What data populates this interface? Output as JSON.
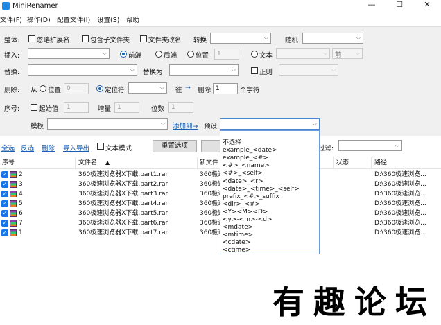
{
  "window": {
    "title": "MiniRenamer",
    "minimize": "—",
    "maximize": "☐",
    "close": "✕"
  },
  "menu": [
    "文件(F)",
    "操作(D)",
    "配置文件(I)",
    "设置(S)",
    "帮助"
  ],
  "overall": {
    "label": "整体:",
    "ignore_ext": "忽略扩展名",
    "include_subfiles": "包含子文件夹",
    "folder_rename": "文件夹改名",
    "convert_label": "转换",
    "random_label": "随机"
  },
  "insert": {
    "label": "插入:",
    "front": "前端",
    "back": "后端",
    "position": "位置",
    "position_value": "1",
    "text": "文本",
    "before_after": "前"
  },
  "replace": {
    "label": "替换:",
    "replace_with": "替换为",
    "regex": "正则"
  },
  "delete": {
    "label": "删除:",
    "from": "从",
    "position": "位置",
    "position_value": "0",
    "locator": "定位符",
    "to": "往",
    "arrow": "→",
    "delete_word": "删除",
    "count": "1",
    "unit": "个字符"
  },
  "sequence": {
    "label": "序号:",
    "start": "起始值",
    "start_value": "1",
    "increment": "增量",
    "increment_value": "1",
    "digits": "位数",
    "digits_value": "1",
    "template": "模板",
    "add_to": "添加到→",
    "preset": "预设"
  },
  "toolbar": {
    "select_all": "全选",
    "invert": "反选",
    "delete": "删除",
    "import_export": "导入导出",
    "text_mode": "文本模式",
    "reset": "重置选项",
    "filter": "过滤:"
  },
  "grid": {
    "columns": [
      "序号",
      "文件名",
      "新文件",
      "状态",
      "路径"
    ],
    "sort_indicator": "▲",
    "rows": [
      {
        "num": "2",
        "name": "360极速浏览器X下载.part1.rar",
        "new": "360极速",
        "path": "D:\\360极速浏览..."
      },
      {
        "num": "3",
        "name": "360极速浏览器X下载.part2.rar",
        "new": "360极速",
        "path": "D:\\360极速浏览..."
      },
      {
        "num": "4",
        "name": "360极速浏览器X下载.part3.rar",
        "new": "360极速",
        "path": "D:\\360极速浏览..."
      },
      {
        "num": "5",
        "name": "360极速浏览器X下载.part4.rar",
        "new": "360极速",
        "path": "D:\\360极速浏览..."
      },
      {
        "num": "6",
        "name": "360极速浏览器X下载.part5.rar",
        "new": "360极速",
        "path": "D:\\360极速浏览..."
      },
      {
        "num": "7",
        "name": "360极速浏览器X下载.part6.rar",
        "new": "360极速",
        "path": "D:\\360极速浏览..."
      },
      {
        "num": "1",
        "name": "360极速浏览器X下载.part7.rar",
        "new": "360极速",
        "path": "D:\\360极速浏览..."
      }
    ]
  },
  "preset_dropdown": [
    "不选择",
    "example_<date>",
    "example_<#>",
    "<#>_<name>",
    "<#>_<self>",
    "<date>_<r>",
    "<date>_<time>_<self>",
    "prefix_<#>_suffix",
    "<dir>_<#>",
    "<Y><M><D>",
    "<y>-<m>-<d>",
    "<mdate>",
    "<mtime>",
    "<cdate>",
    "<ctime>"
  ],
  "watermark": [
    "有",
    "趣",
    "论",
    "坛"
  ],
  "colors": {
    "accent": "#1a5fb4",
    "panel_bg": "#f0f0f0",
    "dropdown_border": "#6b9bd8"
  }
}
